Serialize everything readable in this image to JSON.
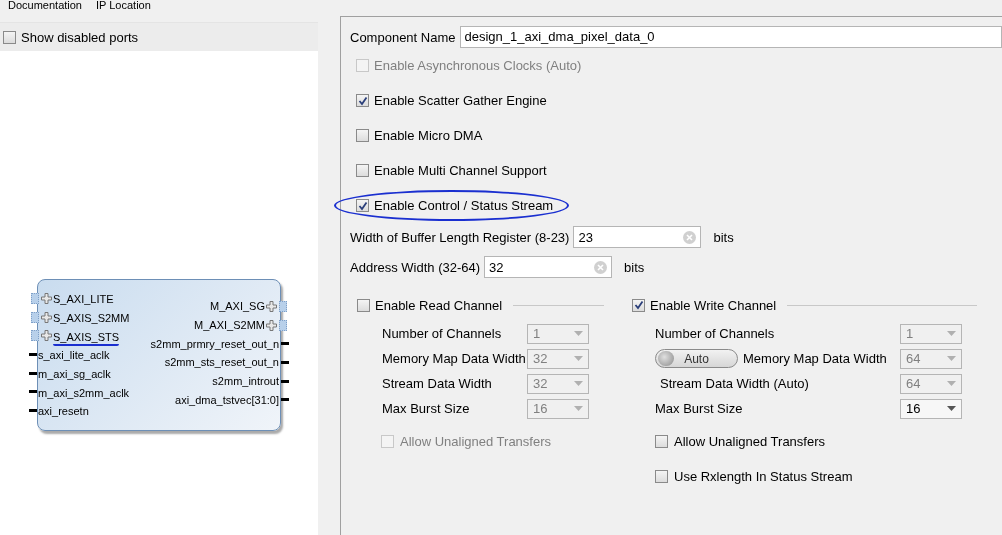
{
  "toolbar": [
    {
      "label": "Documentation"
    },
    {
      "label": "IP Location"
    }
  ],
  "left_panel": {
    "show_disabled_ports": {
      "label": "Show disabled ports",
      "checked": false
    },
    "block": {
      "left_ports": [
        {
          "name": "S_AXI_LITE",
          "kind": "bus",
          "underlined": false
        },
        {
          "name": "S_AXIS_S2MM",
          "kind": "bus",
          "underlined": false
        },
        {
          "name": "S_AXIS_STS",
          "kind": "bus",
          "underlined": true
        },
        {
          "name": "s_axi_lite_aclk",
          "kind": "wire",
          "underlined": false
        },
        {
          "name": "m_axi_sg_aclk",
          "kind": "wire",
          "underlined": false
        },
        {
          "name": "m_axi_s2mm_aclk",
          "kind": "wire",
          "underlined": false
        },
        {
          "name": "axi_resetn",
          "kind": "wire",
          "underlined": false
        }
      ],
      "right_ports": [
        {
          "name": "M_AXI_SG",
          "kind": "bus"
        },
        {
          "name": "M_AXI_S2MM",
          "kind": "bus"
        },
        {
          "name": "s2mm_prmry_reset_out_n",
          "kind": "wire"
        },
        {
          "name": "s2mm_sts_reset_out_n",
          "kind": "wire"
        },
        {
          "name": "s2mm_introut",
          "kind": "wire"
        },
        {
          "name": "axi_dma_tstvec[31:0]",
          "kind": "wire"
        }
      ]
    }
  },
  "component_name": {
    "label": "Component Name",
    "value": "design_1_axi_dma_pixel_data_0"
  },
  "options": [
    {
      "label": "Enable Asynchronous Clocks (Auto)",
      "checked": false,
      "disabled": true,
      "circled": false
    },
    {
      "label": "Enable Scatter Gather Engine",
      "checked": true,
      "disabled": false,
      "circled": false
    },
    {
      "label": "Enable Micro DMA",
      "checked": false,
      "disabled": false,
      "circled": false
    },
    {
      "label": "Enable Multi Channel Support",
      "checked": false,
      "disabled": false,
      "circled": false
    },
    {
      "label": "Enable Control / Status Stream",
      "checked": true,
      "disabled": false,
      "circled": true
    }
  ],
  "fields": [
    {
      "label": "Width of Buffer Length Register (8-23)",
      "value": "23",
      "unit": "bits"
    },
    {
      "label": "Address Width (32-64)",
      "value": "32",
      "unit": "bits"
    }
  ],
  "channels": [
    {
      "label": "Enable Read Channel",
      "checked": false,
      "rows": [
        {
          "kind": "plain",
          "label": "Number of Channels",
          "value": "1",
          "disabled": true
        },
        {
          "kind": "plain",
          "label": "Memory Map Data Width",
          "value": "32",
          "disabled": true
        },
        {
          "kind": "plain",
          "label": "Stream Data Width",
          "value": "32",
          "disabled": true
        },
        {
          "kind": "plain",
          "label": "Max Burst Size",
          "value": "16",
          "disabled": true
        }
      ],
      "checks": [
        {
          "label": "Allow Unaligned Transfers",
          "checked": false,
          "disabled": true
        }
      ]
    },
    {
      "label": "Enable Write Channel",
      "checked": true,
      "rows": [
        {
          "kind": "plain",
          "label": "Number of Channels",
          "value": "1",
          "disabled": true
        },
        {
          "kind": "auto",
          "toggle": "Auto",
          "label": "Memory Map Data Width",
          "value": "64",
          "disabled": true
        },
        {
          "kind": "indented",
          "label": "Stream Data Width (Auto)",
          "value": "64",
          "disabled": true
        },
        {
          "kind": "plain",
          "label": "Max Burst Size",
          "value": "16",
          "disabled": false
        }
      ],
      "checks": [
        {
          "label": "Allow Unaligned Transfers",
          "checked": false,
          "disabled": false
        },
        {
          "label": "Use Rxlength In Status Stream",
          "checked": false,
          "disabled": false
        }
      ]
    }
  ]
}
